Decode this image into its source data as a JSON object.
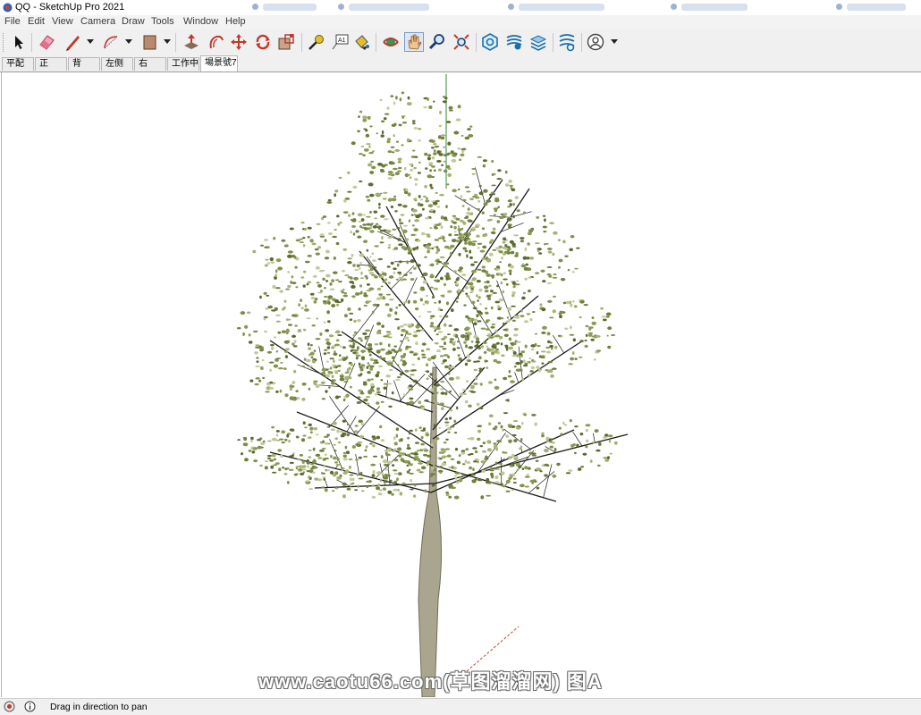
{
  "window": {
    "title": "QQ - SketchUp Pro 2021"
  },
  "menu": [
    "File",
    "Edit",
    "View",
    "Camera",
    "Draw",
    "Tools",
    "Window",
    "Help"
  ],
  "toolbar": {
    "tools": [
      {
        "icon": "select-arrow-icon"
      },
      {
        "icon": "eraser-icon"
      },
      {
        "icon": "pencil-line-icon",
        "dropdown": true
      },
      {
        "icon": "arc-icon",
        "dropdown": true
      },
      {
        "icon": "rectangle-shape-icon",
        "dropdown": true
      },
      {
        "icon": "push-pull-icon"
      },
      {
        "icon": "offset-icon"
      },
      {
        "icon": "move-icon"
      },
      {
        "icon": "rotate-icon"
      },
      {
        "icon": "scale-icon"
      },
      {
        "icon": "tape-measure-icon"
      },
      {
        "icon": "text-label-icon"
      },
      {
        "icon": "paint-bucket-icon"
      },
      {
        "icon": "orbit-icon"
      },
      {
        "icon": "pan-hand-icon",
        "active": true
      },
      {
        "icon": "zoom-icon"
      },
      {
        "icon": "zoom-extents-icon"
      },
      {
        "icon": "3d-warehouse-icon"
      },
      {
        "icon": "extension-warehouse-icon"
      },
      {
        "icon": "layout-icon"
      },
      {
        "icon": "extension-manager-icon"
      },
      {
        "icon": "user-account-icon",
        "dropdown": true
      }
    ]
  },
  "scene_tabs": [
    {
      "label": "平配"
    },
    {
      "label": "正"
    },
    {
      "label": "背"
    },
    {
      "label": "左侧"
    },
    {
      "label": "右"
    },
    {
      "label": "工作中"
    },
    {
      "label": "場景號7",
      "active": true
    }
  ],
  "watermark": "www.caotu66.com(草图溜溜网) 图A",
  "status": {
    "text": "Drag in direction to pan",
    "icons": [
      "geo-location-icon",
      "info-icon"
    ]
  },
  "colors": {
    "foliage": "#7e8f4a",
    "branches": "#1b1b18",
    "trunk": "#a9a58e",
    "active_tool_bg": "#dde6f2"
  }
}
